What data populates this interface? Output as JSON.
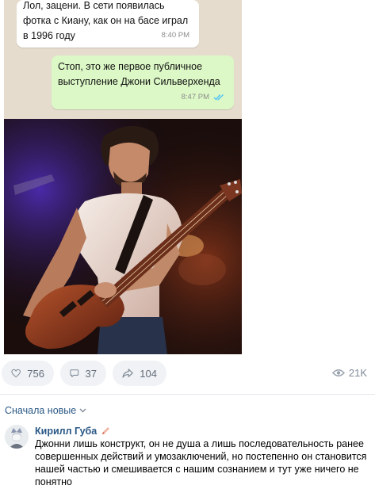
{
  "chat": {
    "incoming": {
      "text": "Лол, зацени. В сети появилась фотка с Киану, как он на басе играл в 1996 году",
      "time": "8:40 PM"
    },
    "outgoing": {
      "text": "Стоп, это же первое публичное выступление Джони Сильверхенда",
      "time": "8:47 PM",
      "status_icon": "double-check-icon"
    },
    "photo": {
      "subject": "man-playing-bass-guitar"
    }
  },
  "actions": {
    "likes": "756",
    "comments": "37",
    "shares": "104",
    "views": "21K"
  },
  "comments_section": {
    "sort_label": "Сначала новые",
    "comment": {
      "author": "Кирилл Губа",
      "text": "Джонни лишь конструкт, он не душа а лишь последовательность ранее совершенных действий и умозаключений, но постепенно он становится нашей частью и смешивается с нашим сознанием и тут уже ничего не понятно"
    }
  },
  "colors": {
    "link": "#2a5885",
    "pill_bg": "#f0f2f5",
    "incoming_bubble": "#ffffff",
    "outgoing_bubble": "#dcf8c6",
    "read_check": "#4fc3f7"
  }
}
